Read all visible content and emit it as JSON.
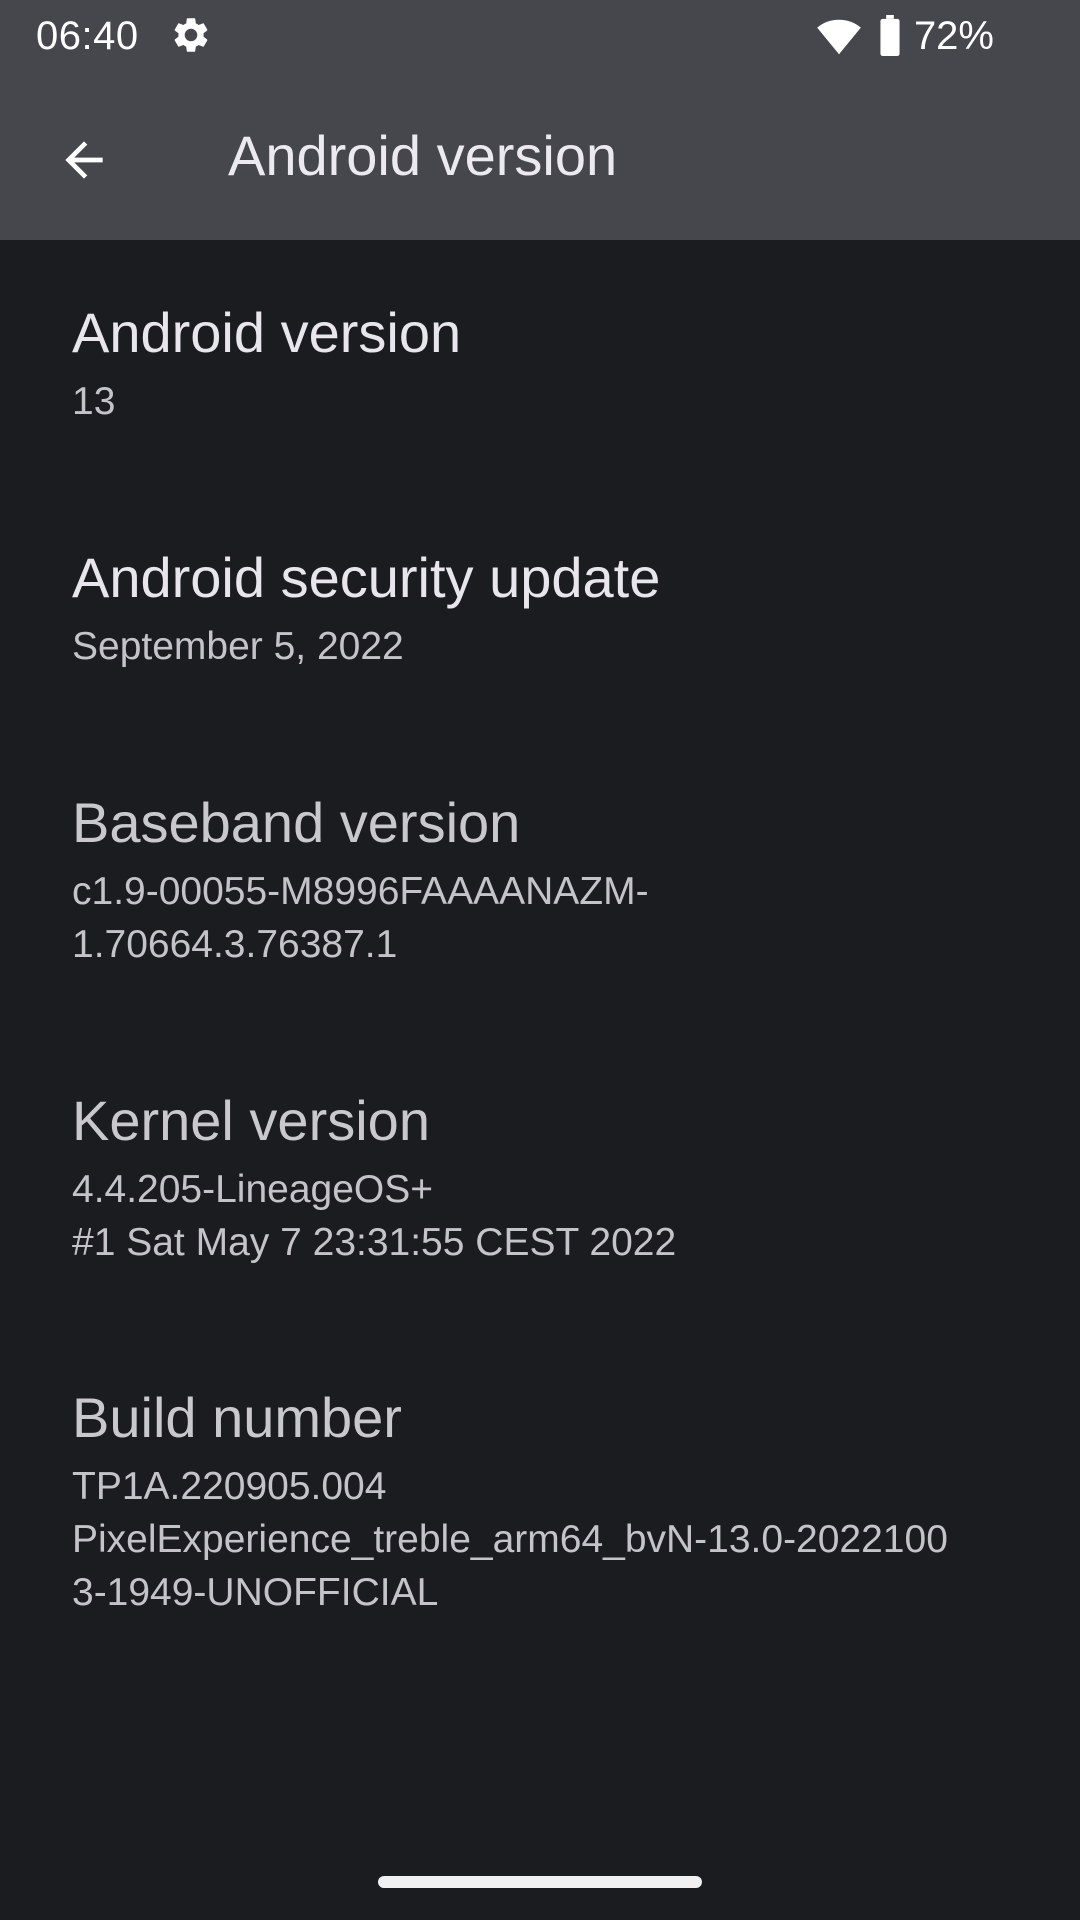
{
  "status_bar": {
    "time": "06:40",
    "settings_icon": "gear-icon",
    "wifi_icon": "wifi-icon",
    "battery_icon": "battery-icon",
    "battery_percent": "72%"
  },
  "app_bar": {
    "back_icon": "arrow-back-icon",
    "title": "Android version"
  },
  "items": [
    {
      "title": "Android version",
      "summary": "13"
    },
    {
      "title": "Android security update",
      "summary": "September 5, 2022"
    },
    {
      "title": "Baseband version",
      "summary": "c1.9-00055-M8996FAAAANAZM-\n1.70664.3.76387.1"
    },
    {
      "title": "Kernel version",
      "summary": "4.4.205-LineageOS+\n#1 Sat May 7 23:31:55 CEST 2022"
    },
    {
      "title": "Build number",
      "summary": "TP1A.220905.004\nPixelExperience_treble_arm64_bvN-13.0-2022100\n3-1949-UNOFFICIAL"
    }
  ],
  "colors": {
    "app_bar_bg": "#46474c",
    "screen_bg": "#1b1c20",
    "text_primary": "#e8e6ec",
    "text_secondary": "#c4c3c9"
  }
}
